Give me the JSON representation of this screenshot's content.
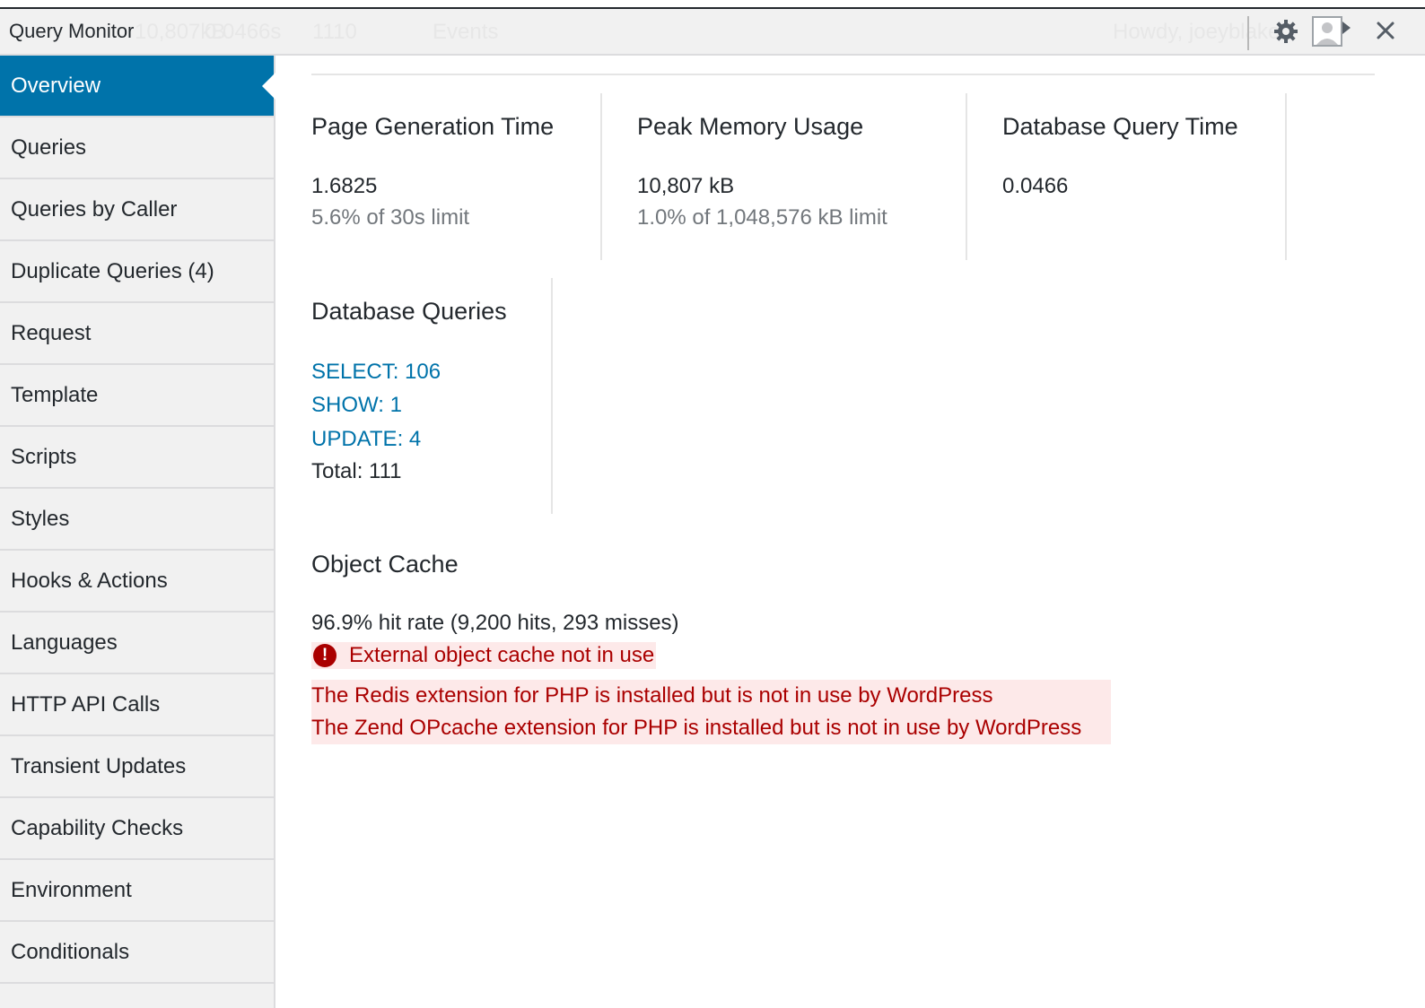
{
  "window": {
    "title": "Query Monitor",
    "ghost_bar": [
      "10,807kB",
      "0.0466s",
      "1110",
      "Events",
      "Howdy, joeyblake"
    ],
    "icons": [
      "gear-icon",
      "avatar-icon",
      "close-icon"
    ]
  },
  "sidebar": {
    "items": [
      {
        "label": "Overview",
        "active": true
      },
      {
        "label": "Queries"
      },
      {
        "label": "Queries by Caller"
      },
      {
        "label": "Duplicate Queries (4)"
      },
      {
        "label": "Request"
      },
      {
        "label": "Template"
      },
      {
        "label": "Scripts"
      },
      {
        "label": "Styles"
      },
      {
        "label": "Hooks & Actions"
      },
      {
        "label": "Languages"
      },
      {
        "label": "HTTP API Calls"
      },
      {
        "label": "Transient Updates"
      },
      {
        "label": "Capability Checks"
      },
      {
        "label": "Environment"
      },
      {
        "label": "Conditionals"
      }
    ]
  },
  "overview": {
    "page_generation": {
      "heading": "Page Generation Time",
      "value": "1.6825",
      "sub": "5.6% of 30s limit"
    },
    "peak_memory": {
      "heading": "Peak Memory Usage",
      "value": "10,807 kB",
      "sub": "1.0% of 1,048,576 kB limit"
    },
    "db_query_time": {
      "heading": "Database Query Time",
      "value": "0.0466"
    },
    "db_queries": {
      "heading": "Database Queries",
      "links": [
        "SELECT: 106",
        "SHOW: 1",
        "UPDATE: 4"
      ],
      "total": "Total: 111"
    },
    "object_cache": {
      "heading": "Object Cache",
      "hit_rate": "96.9% hit rate (9,200 hits, 293 misses)",
      "warning": "External object cache not in use",
      "notices": [
        "The Redis extension for PHP is installed but is not in use by WordPress",
        "The Zend OPcache extension for PHP is installed but is not in use by WordPress"
      ]
    }
  },
  "colors": {
    "accent": "#0073aa",
    "error": "#aa0000",
    "error_bg": "#fde9e9",
    "sidebar_bg": "#f1f1f1"
  }
}
